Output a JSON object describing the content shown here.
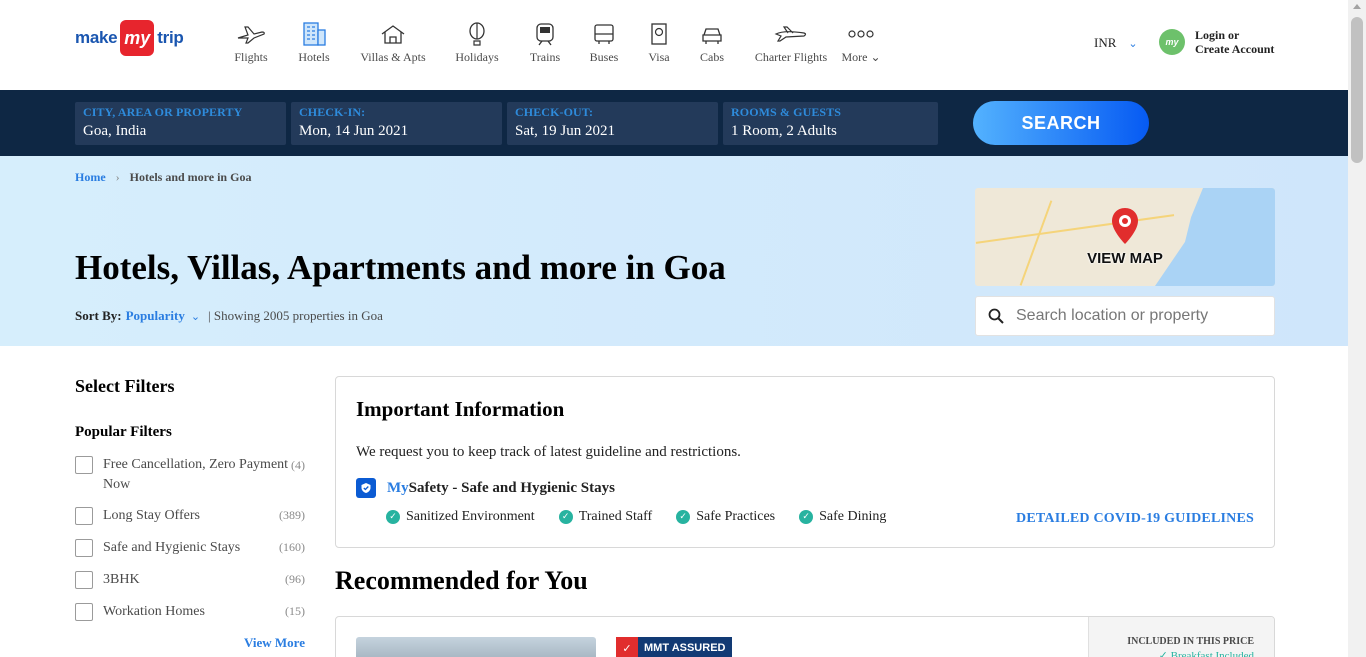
{
  "brand": {
    "make": "make",
    "my": "my",
    "trip": "trip"
  },
  "nav": [
    {
      "label": "Flights",
      "icon": "flight-icon"
    },
    {
      "label": "Hotels",
      "icon": "hotel-icon"
    },
    {
      "label": "Villas & Apts",
      "icon": "villa-icon"
    },
    {
      "label": "Holidays",
      "icon": "holiday-icon"
    },
    {
      "label": "Trains",
      "icon": "train-icon"
    },
    {
      "label": "Buses",
      "icon": "bus-icon"
    },
    {
      "label": "Visa",
      "icon": "visa-icon"
    },
    {
      "label": "Cabs",
      "icon": "cab-icon"
    },
    {
      "label": "Charter Flights",
      "icon": "charter-flight-icon"
    },
    {
      "label": "More",
      "icon": "more-icon"
    }
  ],
  "currency": "INR",
  "login": {
    "line1": "Login or",
    "line2": "Create Account",
    "avatar": "my"
  },
  "search": {
    "city": {
      "label": "CITY, AREA OR PROPERTY",
      "value": "Goa, India"
    },
    "checkin": {
      "label": "CHECK-IN:",
      "value": "Mon, 14 Jun 2021"
    },
    "checkout": {
      "label": "CHECK-OUT:",
      "value": "Sat, 19 Jun 2021"
    },
    "rooms": {
      "label": "ROOMS & GUESTS",
      "value": "1 Room, 2 Adults"
    },
    "button": "SEARCH"
  },
  "breadcrumb": {
    "home": "Home",
    "current": "Hotels and more in Goa"
  },
  "hero": {
    "title": "Hotels, Villas, Apartments and more in Goa",
    "sort_by_label": "Sort By:",
    "sort_value": "Popularity",
    "showing": "| Showing 2005 properties in Goa",
    "view_map": "VIEW MAP",
    "search_placeholder": "Search location or property"
  },
  "filters": {
    "title": "Select Filters",
    "popular_title": "Popular Filters",
    "items": [
      {
        "label": "Free Cancellation, Zero Payment Now",
        "count": "(4)"
      },
      {
        "label": "Long Stay Offers",
        "count": "(389)"
      },
      {
        "label": "Safe and Hygienic Stays",
        "count": "(160)"
      },
      {
        "label": "3BHK",
        "count": "(96)"
      },
      {
        "label": "Workation Homes",
        "count": "(15)"
      }
    ],
    "view_more": "View More"
  },
  "info": {
    "title": "Important Information",
    "desc": "We request you to keep track of latest guideline and restrictions.",
    "mysafety_my": "My",
    "mysafety_rest": "Safety - Safe and Hygienic Stays",
    "chips": [
      "Sanitized Environment",
      "Trained Staff",
      "Safe Practices",
      "Safe Dining"
    ],
    "link": "DETAILED COVID-19 GUIDELINES"
  },
  "recommended": {
    "title": "Recommended for You",
    "badge": "MMT ASSURED",
    "included": "INCLUDED IN THIS PRICE",
    "breakfast": "✓ Breakfast Included"
  },
  "colors": {
    "accent": "#2a7de1",
    "navy": "#0e2744",
    "brand_red": "#e7252d"
  }
}
